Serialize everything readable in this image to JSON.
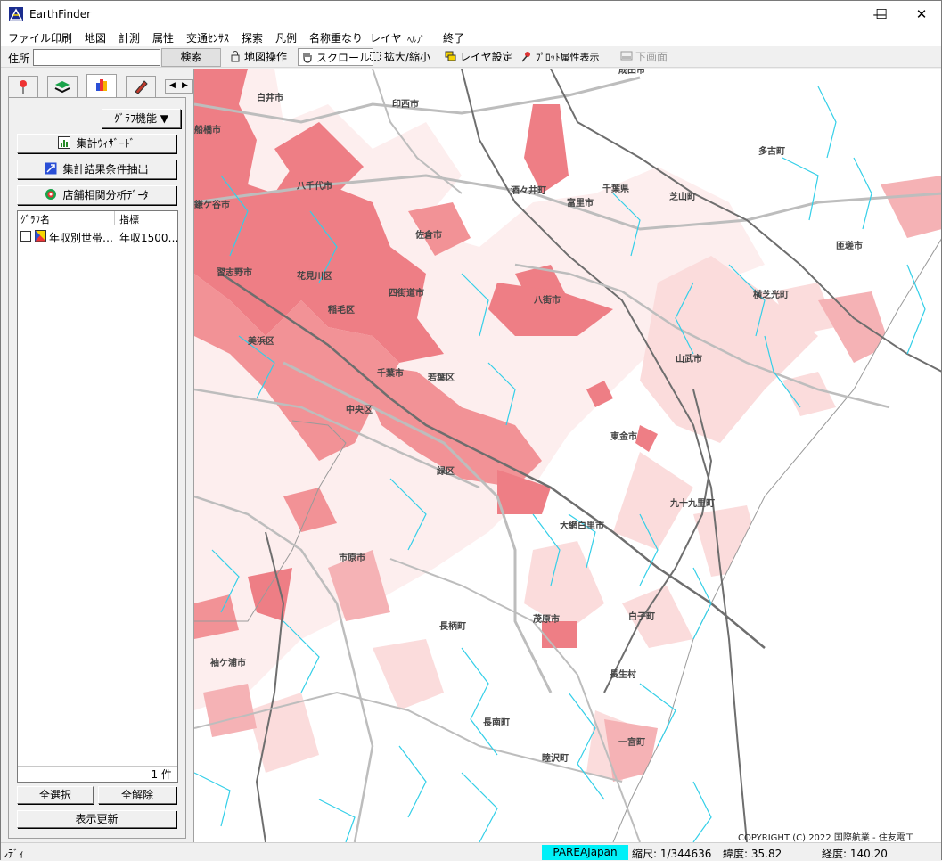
{
  "app": {
    "title": "EarthFinder"
  },
  "window_controls": {
    "minimize": "—",
    "maximize": "☐",
    "close": "✕"
  },
  "menu": [
    "ファイル",
    "印刷",
    "地図",
    "計測",
    "属性",
    "交通ｾﾝｻｽ",
    "探索",
    "凡例",
    "名称重なり",
    "レイヤ",
    "ﾍﾙﾌﾟ",
    "終了"
  ],
  "toolbar": {
    "address_label": "住所",
    "address_value": "",
    "search_label": "検索",
    "map_ops_label": "地図操作",
    "scroll_label": "スクロール",
    "zoom_label": "拡大/縮小",
    "layer_settings_label": "レイヤ設定",
    "plot_attr_label": "ﾌﾟﾛｯﾄ属性表示",
    "lower_screen_label": "下画面"
  },
  "side_panel": {
    "graph_function_label": "ｸﾞﾗﾌ機能 ▼",
    "buttons": [
      "集計ｳｨｻﾞｰﾄﾞ",
      "集計結果条件抽出",
      "店舗相関分析ﾃﾞｰﾀ"
    ],
    "list": {
      "columns": [
        "ｸﾞﾗﾌ名",
        "指標"
      ],
      "rows": [
        {
          "name": "年収別世帯…",
          "indicator": "年収1500…",
          "checked": false
        }
      ],
      "count_label": "1 件"
    },
    "select_all_label": "全選択",
    "deselect_all_label": "全解除",
    "refresh_label": "表示更新"
  },
  "map": {
    "copyright": "COPYRIGHT (C) 2022 国際航業 - 住友電工",
    "labels": [
      "成田市",
      "白井市",
      "印西市",
      "八千代市",
      "鎌ケ谷市",
      "佐倉市",
      "酒々井町",
      "富里市",
      "多古町",
      "芝山町",
      "横芝光町",
      "匝瑳市",
      "習志野市",
      "花見川区",
      "四街道市",
      "稲毛区",
      "八街市",
      "美浜区",
      "千葉市",
      "若葉区",
      "中央区",
      "山武市",
      "緑区",
      "東金市",
      "大網白里市",
      "九十九里町",
      "市原市",
      "長柄町",
      "茂原市",
      "白子町",
      "袖ケ浦市",
      "長生村",
      "長南町",
      "一宮町",
      "睦沢町",
      "千葉県",
      "船橋市"
    ],
    "colors": {
      "water": "#33cfe8",
      "road": "#b8b8b8",
      "highway": "#6e6e6e",
      "choropleth_dark": "#ee7e85",
      "choropleth_mid": "#f5b2b5",
      "choropleth_light": "#fbdcdc"
    }
  },
  "status": {
    "ready": "ﾚﾃﾞｨ",
    "layer": "PAREAJapan",
    "scale": "縮尺: 1/344636",
    "latitude": "緯度: 35.82",
    "longitude": "経度: 140.20"
  }
}
